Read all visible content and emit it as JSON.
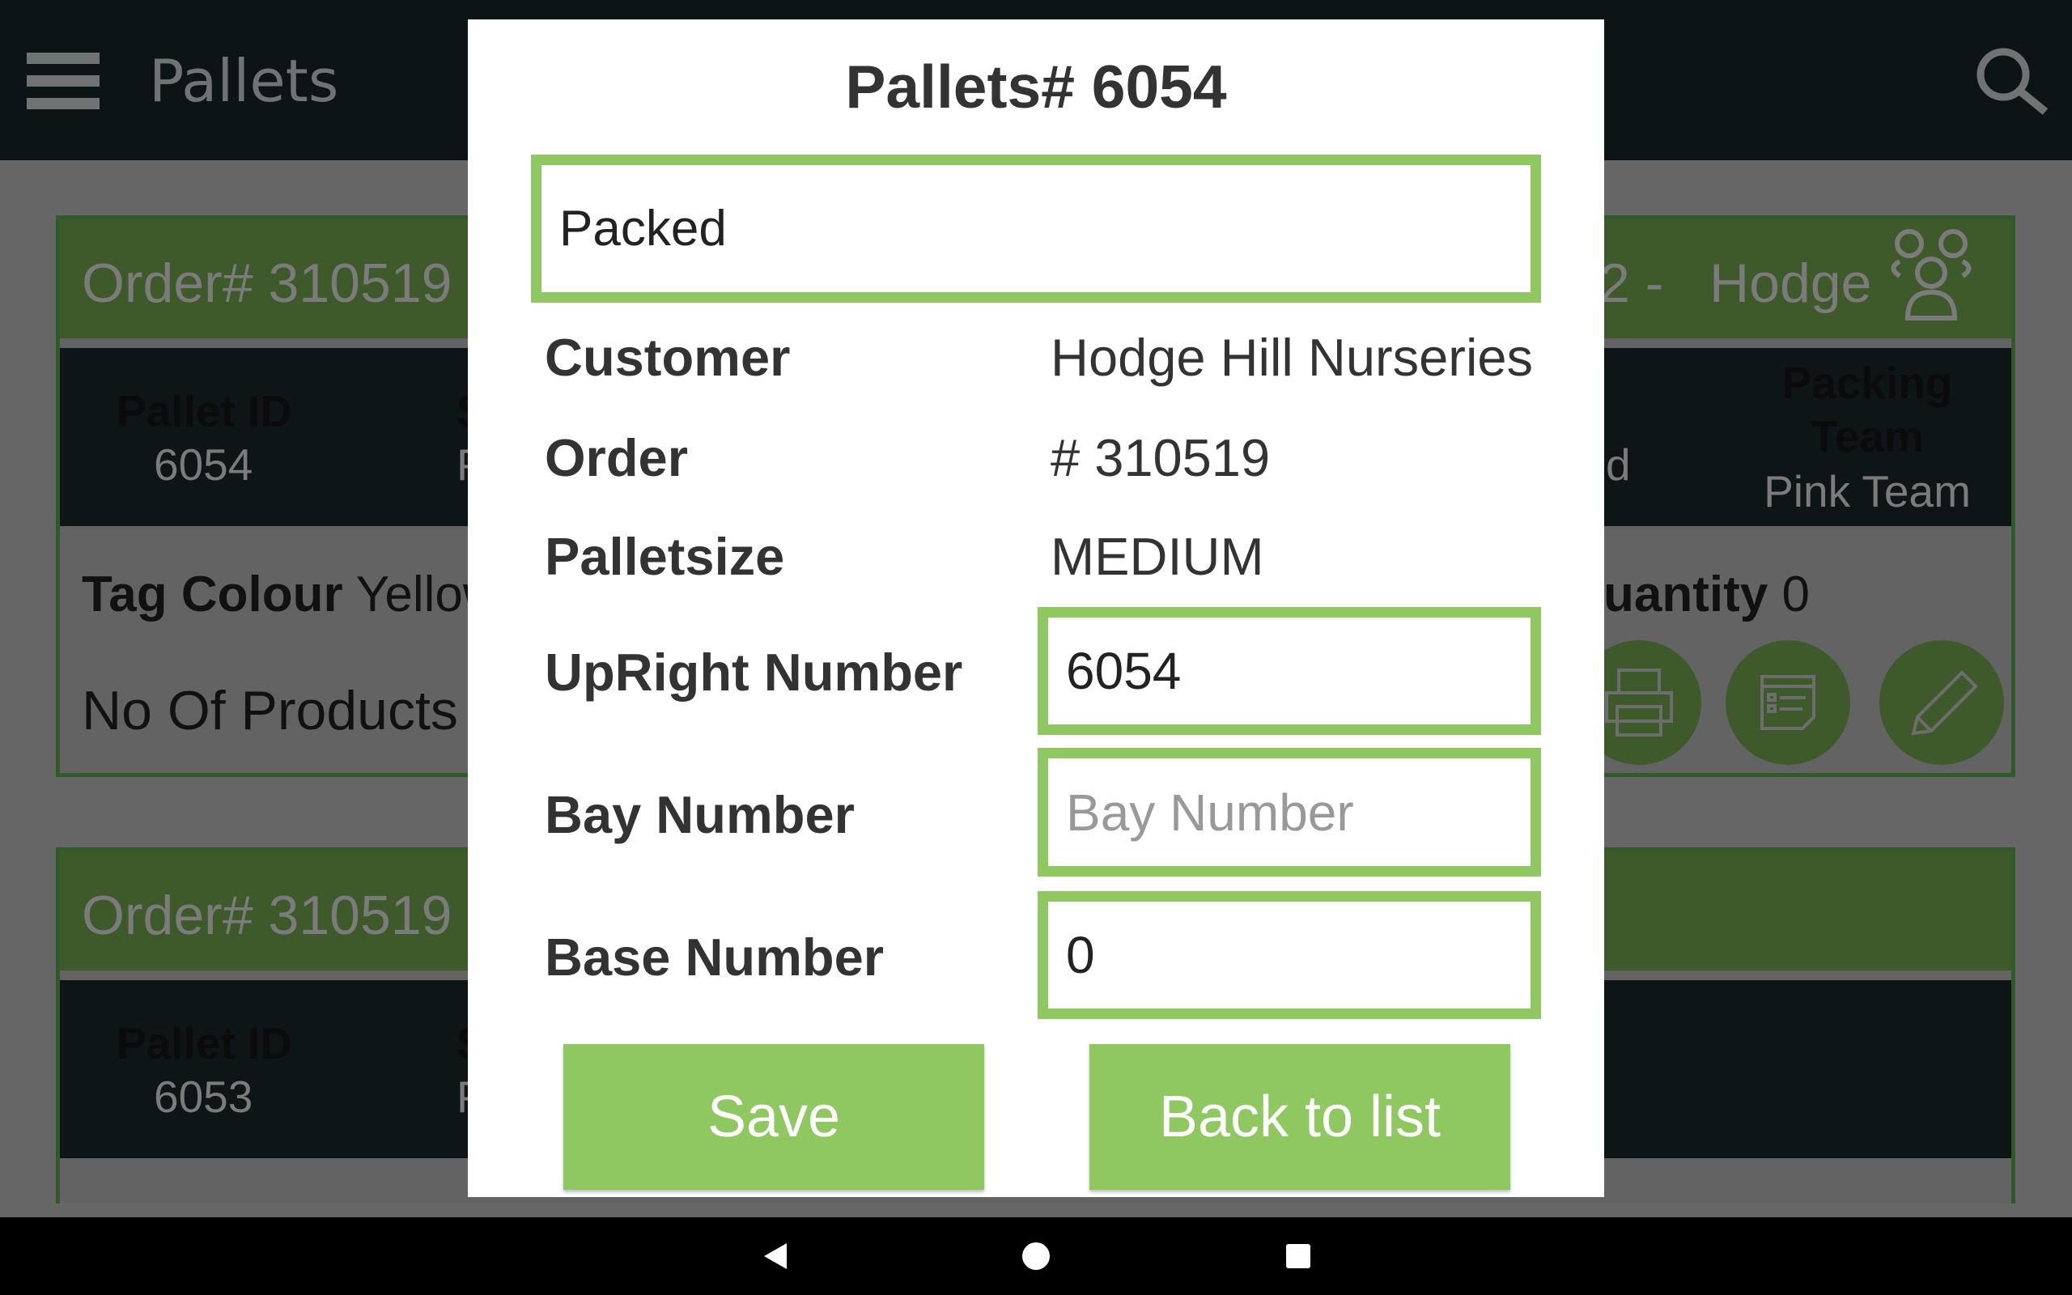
{
  "app": {
    "title": "Pallets",
    "menu_icon": "hamburger-icon",
    "search_icon": "search-icon"
  },
  "background_cards": [
    {
      "order_header": "Order# 310519 -",
      "order_header_right": "2 -   Hodge",
      "pallet_id_label": "Pallet ID",
      "pallet_id": "6054",
      "status_partial_label": "S",
      "status_partial_value": "P",
      "status_right_partial": "d",
      "packing_team_label": "Packing Team",
      "packing_team": "Pink Team",
      "tag_colour_label": "Tag Colour",
      "tag_colour": "Yellow",
      "quantity_label": "uantity",
      "quantity": "0",
      "products_label": "No Of Products"
    },
    {
      "order_header": "Order# 310519 -",
      "pallet_id_label": "Pallet ID",
      "pallet_id": "6053",
      "status_partial_label": "S",
      "status_partial_value": "P"
    }
  ],
  "dialog": {
    "title": "Pallets# 6054",
    "status_value": "Packed",
    "rows": [
      {
        "label": "Customer",
        "value": "Hodge Hill Nurseries"
      },
      {
        "label": "Order",
        "value": "# 310519"
      },
      {
        "label": "Palletsize",
        "value": "MEDIUM"
      }
    ],
    "upright": {
      "label": "UpRight Number",
      "value": "6054"
    },
    "bay": {
      "label": "Bay Number",
      "value": "",
      "placeholder": "Bay Number"
    },
    "base": {
      "label": "Base Number",
      "value": "0"
    },
    "save_label": "Save",
    "back_label": "Back to list"
  },
  "colors": {
    "accent": "#8fc760",
    "header": "#0d1416"
  }
}
